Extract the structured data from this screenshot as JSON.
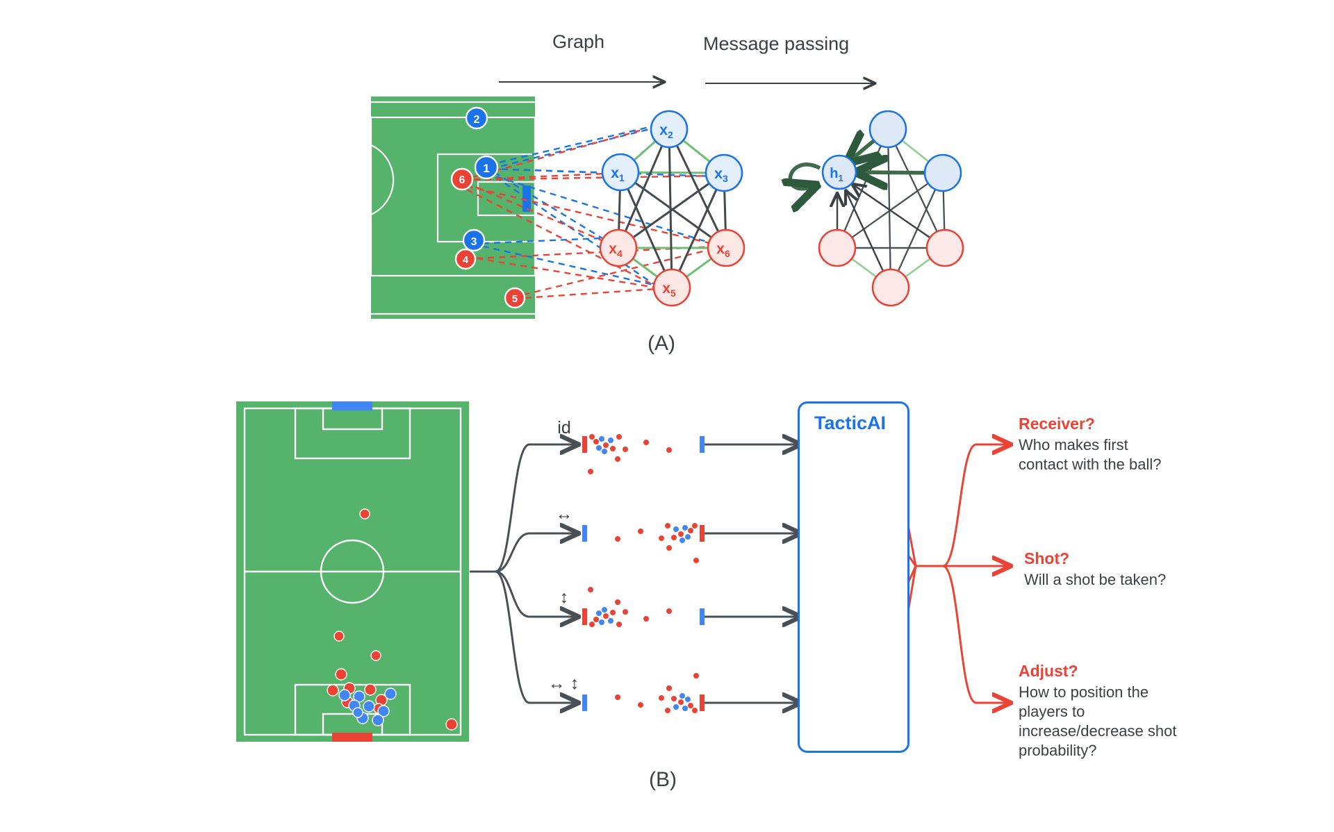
{
  "figure": {
    "panels": [
      {
        "id": "A",
        "label": "(A)"
      },
      {
        "id": "B",
        "label": "(B)"
      }
    ]
  },
  "panel_a": {
    "arrows": [
      {
        "name": "graph-arrow",
        "label": "Graph"
      },
      {
        "name": "message-passing-arrow",
        "label": "Message passing"
      }
    ],
    "pitch": {
      "players": [
        {
          "id": "1",
          "label": "1",
          "team": "blue"
        },
        {
          "id": "2",
          "label": "2",
          "team": "blue"
        },
        {
          "id": "3",
          "label": "3",
          "team": "blue"
        },
        {
          "id": "4",
          "label": "4",
          "team": "red"
        },
        {
          "id": "5",
          "label": "5",
          "team": "red"
        },
        {
          "id": "6",
          "label": "6",
          "team": "red"
        }
      ],
      "ball_marker": "blue-bar"
    },
    "graph_nodes": [
      {
        "name": "node-x1",
        "label": "x",
        "sub": "1",
        "team": "blue"
      },
      {
        "name": "node-x2",
        "label": "x",
        "sub": "2",
        "team": "blue"
      },
      {
        "name": "node-x3",
        "label": "x",
        "sub": "3",
        "team": "blue"
      },
      {
        "name": "node-x4",
        "label": "x",
        "sub": "4",
        "team": "red"
      },
      {
        "name": "node-x5",
        "label": "x",
        "sub": "5",
        "team": "red"
      },
      {
        "name": "node-x6",
        "label": "x",
        "sub": "6",
        "team": "red"
      }
    ],
    "message_passing": {
      "focus_node": {
        "name": "node-h1",
        "label": "h",
        "sub": "1",
        "team": "blue"
      },
      "self_loop": true
    }
  },
  "panel_b": {
    "transforms": [
      {
        "name": "transform-identity",
        "label": "id"
      },
      {
        "name": "transform-horizontal-flip",
        "label": "↔"
      },
      {
        "name": "transform-vertical-flip",
        "label": "↕"
      },
      {
        "name": "transform-both-flip",
        "label": "↔ ↕"
      }
    ],
    "model": {
      "name": "tacticai-box",
      "title": "TacticAI"
    },
    "outputs": [
      {
        "name": "output-receiver",
        "head": "Receiver?",
        "body": "Who makes first contact with the ball?"
      },
      {
        "name": "output-shot",
        "head": "Shot?",
        "body": "Will a shot be taken?"
      },
      {
        "name": "output-adjust",
        "head": "Adjust?",
        "body": "How to position the players to increase/decrease shot probability?"
      }
    ]
  },
  "colors": {
    "pitch_green": "#56b36b",
    "blue": "#1a73e8",
    "red": "#ea4335",
    "dark": "#3c4043",
    "edge_green": "#6cbf73",
    "edge_dark": "#444a4d"
  }
}
